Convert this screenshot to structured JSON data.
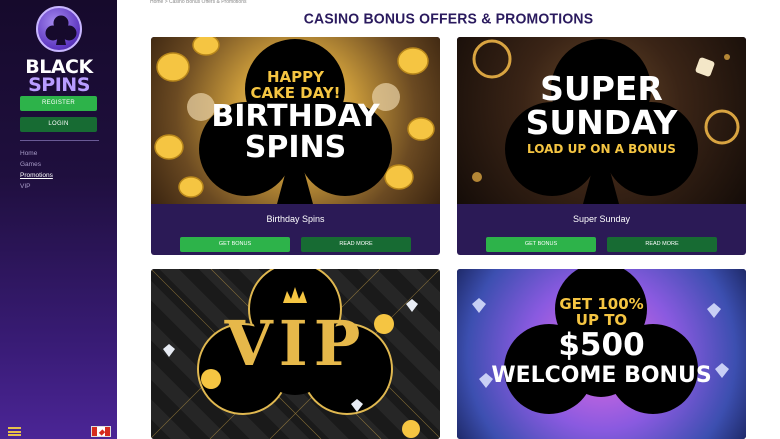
{
  "sidebar": {
    "logo": {
      "line1": "BLACK",
      "line2": "SPINS"
    },
    "register_label": "REGISTER",
    "login_label": "LOGIN",
    "nav": [
      "Home",
      "Games",
      "Promotions",
      "VIP"
    ],
    "active_nav": "Promotions"
  },
  "breadcrumb": "Home > Casino Bonus Offers & Promotions",
  "page_title": "CASINO BONUS OFFERS & PROMOTIONS",
  "cards": [
    {
      "title": "Birthday Spins",
      "line1": "HAPPY",
      "line2": "CAKE DAY!",
      "line3": "BIRTHDAY",
      "line4": "SPINS",
      "get_label": "GET BONUS",
      "more_label": "READ MORE"
    },
    {
      "title": "Super Sunday",
      "line1": "SUPER",
      "line2": "SUNDAY",
      "line3": "LOAD UP ON A BONUS",
      "get_label": "GET BONUS",
      "more_label": "READ MORE"
    },
    {
      "line1": "VIP"
    },
    {
      "line1": "GET 100%",
      "line2": "UP TO",
      "line3": "$500",
      "line4": "WELCOME BONUS"
    }
  ],
  "colors": {
    "accent_green": "#2db34a",
    "dark_green": "#176b33",
    "card_bg": "#2b1a56",
    "title": "#2a1a5e",
    "gold": "#f5c542"
  }
}
